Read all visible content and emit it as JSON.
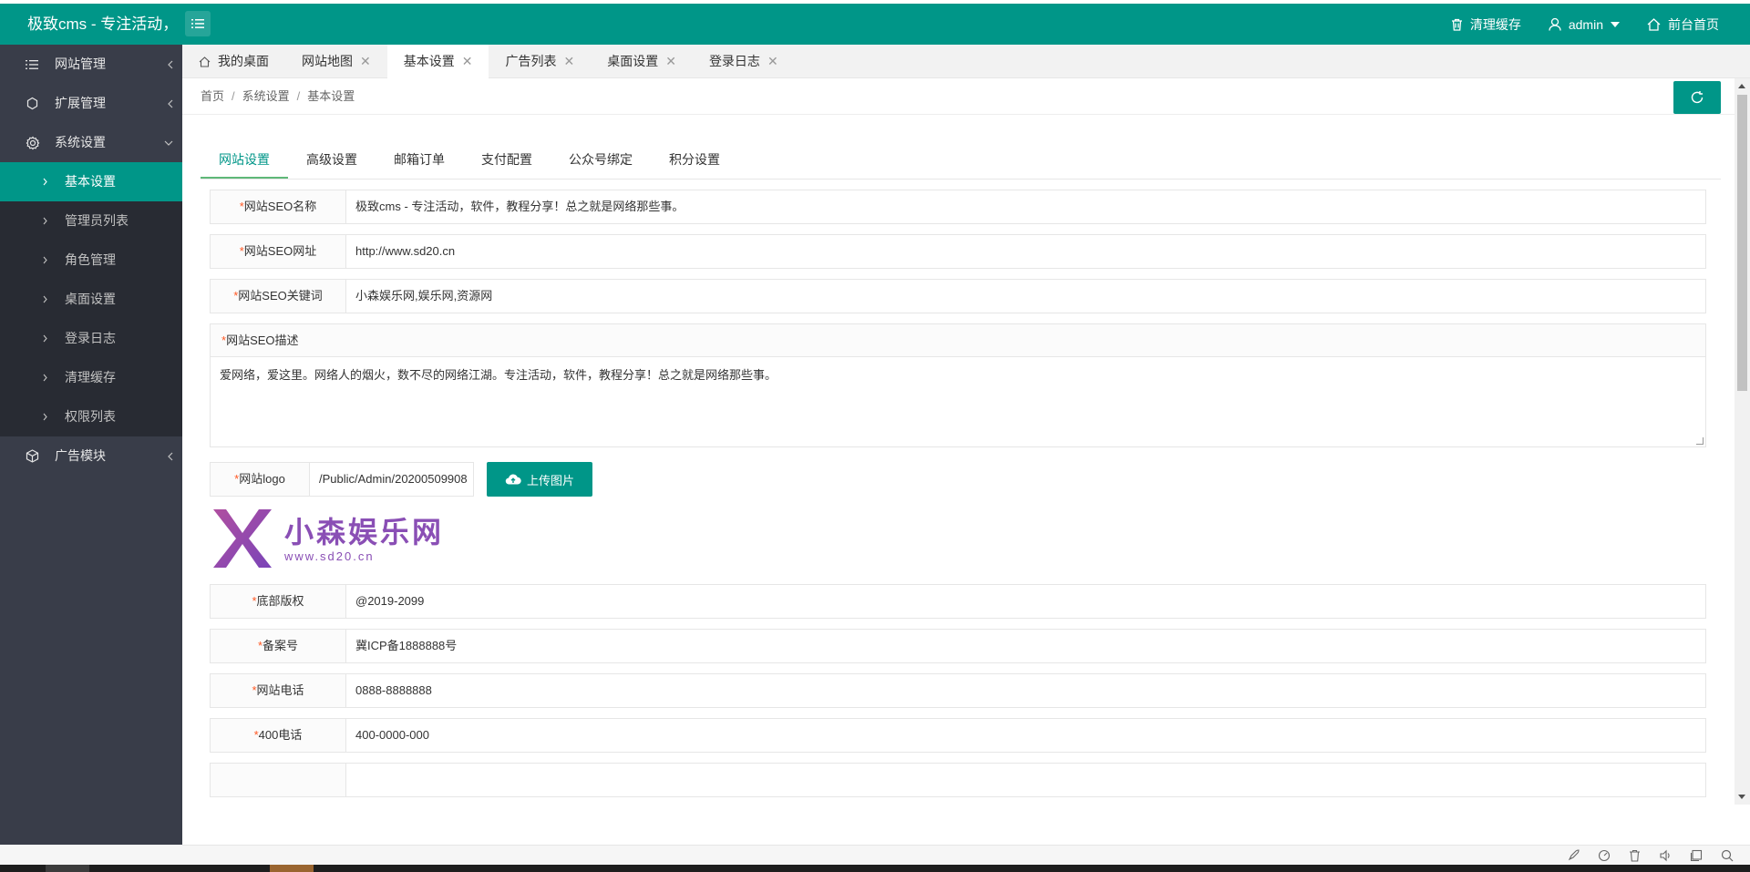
{
  "header": {
    "title": "极致cms - 专注活动，",
    "clear_cache": "清理缓存",
    "user": "admin",
    "home": "前台首页"
  },
  "sidebar": {
    "groups": [
      {
        "label": "网站管理",
        "icon": "list-icon"
      },
      {
        "label": "扩展管理",
        "icon": "puzzle-icon"
      },
      {
        "label": "系统设置",
        "icon": "gear-icon"
      },
      {
        "label": "广告模块",
        "icon": "cube-icon"
      }
    ],
    "sub_items": [
      "基本设置",
      "管理员列表",
      "角色管理",
      "桌面设置",
      "登录日志",
      "清理缓存",
      "权限列表"
    ]
  },
  "tabs": [
    "我的桌面",
    "网站地图",
    "基本设置",
    "广告列表",
    "桌面设置",
    "登录日志"
  ],
  "breadcrumb": [
    "首页",
    "系统设置",
    "基本设置"
  ],
  "form_tabs": [
    "网站设置",
    "高级设置",
    "邮箱订单",
    "支付配置",
    "公众号绑定",
    "积分设置"
  ],
  "fields": {
    "seo_name": {
      "label": "网站SEO名称",
      "value": "极致cms - 专注活动，软件，教程分享！总之就是网络那些事。"
    },
    "seo_url": {
      "label": "网站SEO网址",
      "value": "http://www.sd20.cn"
    },
    "seo_keywords": {
      "label": "网站SEO关键词",
      "value": "小森娱乐网,娱乐网,资源网"
    },
    "seo_desc": {
      "label": "网站SEO描述",
      "value": "爱网络，爱这里。网络人的烟火，数不尽的网络江湖。专注活动，软件，教程分享！总之就是网络那些事。"
    },
    "logo": {
      "label": "网站logo",
      "value": "/Public/Admin/20200509908",
      "upload": "上传图片"
    },
    "copyright": {
      "label": "底部版权",
      "value": "@2019-2099"
    },
    "icp": {
      "label": "备案号",
      "value": "冀ICP备1888888号"
    },
    "phone": {
      "label": "网站电话",
      "value": "0888-8888888"
    },
    "phone400": {
      "label": "400电话",
      "value": "400-0000-000"
    }
  },
  "brand": {
    "name": "小森娱乐网",
    "url": "www.sd20.cn"
  },
  "required_mark": "*",
  "colors": {
    "primary": "#009688",
    "sidebar": "#393D49",
    "sidebar_sub": "#282B33"
  }
}
